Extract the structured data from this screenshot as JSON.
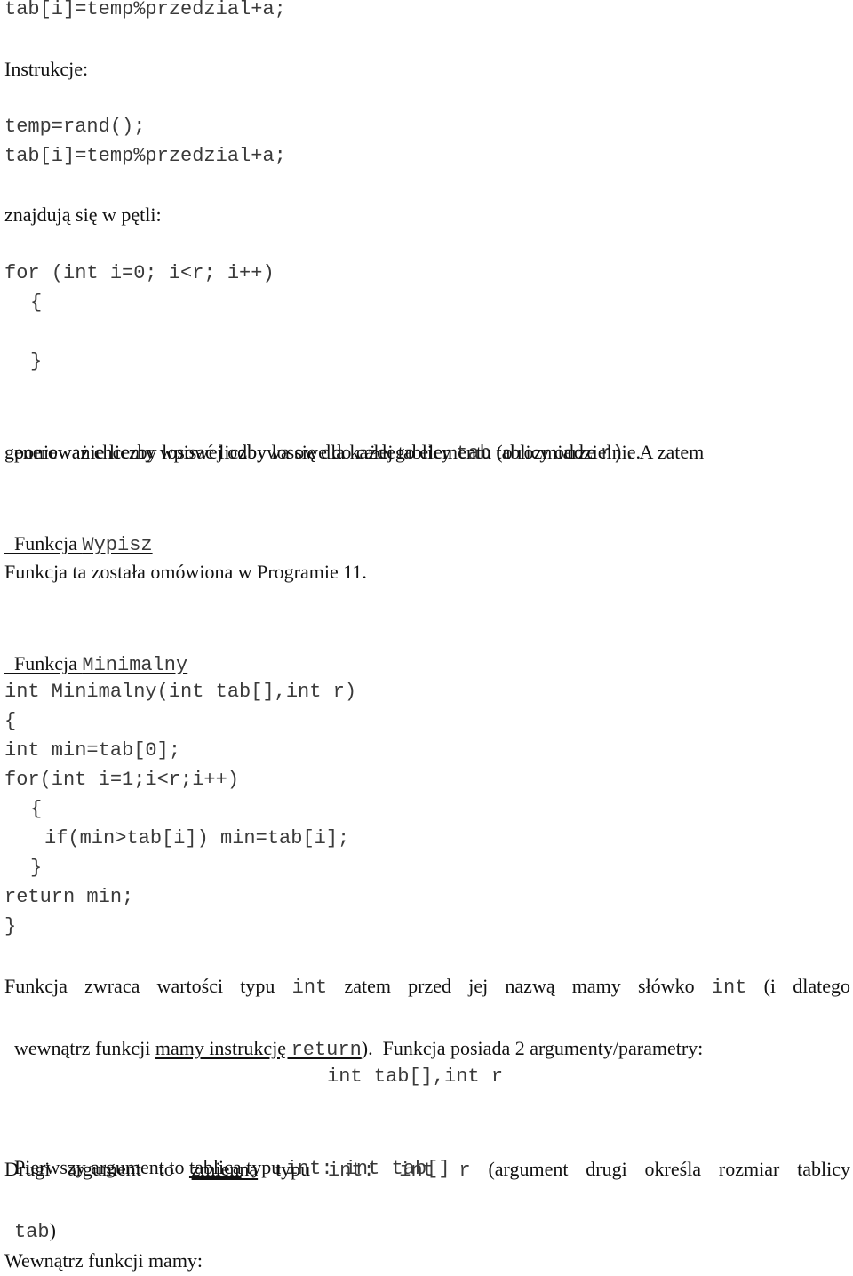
{
  "top_code": {
    "line1": "tab[i]=temp%przedzial+a;"
  },
  "instructions_heading": "Instrukcje:",
  "instructions_code": {
    "line1": "temp=rand();",
    "line2": "tab[i]=temp%przedzial+a;"
  },
  "loop_intro": "znajdują się w pętli:",
  "loop_code": {
    "header": "for (int i=0; i<r; i++)",
    "open_brace": "{",
    "close_brace": "}"
  },
  "explanation": {
    "part1": "ponieważ chcemy wpisać liczby losowe do całej tablicy ",
    "code_tab": "tab",
    "part2": " (o rozmiarze ",
    "code_r": "r).",
    "part3": " A zatem",
    "line2": "generowanie liczby losowej odbywa się dla każdego elementu tablicy oddzielnie."
  },
  "section_wypisz": {
    "label": "Funkcja ",
    "name": "Wypisz",
    "description": "Funkcja ta została omówiona w Programie 11."
  },
  "section_minimalny": {
    "label": "Funkcja ",
    "name": "Minimalny"
  },
  "minimalny_code": [
    "int Minimalny(int tab[],int r)",
    "{",
    "int min=tab[0];",
    "for(int i=1;i<r;i++)",
    "{",
    "if(min>tab[i]) min=tab[i];",
    "}",
    "return min;",
    "}"
  ],
  "return_paragraph": {
    "p1": "Funkcja zwraca wartości typu ",
    "c1": "int",
    "p2": " zatem przed jej nazwą mamy słówko ",
    "c2": "int",
    "p3": " (i dlatego",
    "p4": "wewnątrz funkcji ",
    "u1": "mamy instrukcję ",
    "c3": "return",
    "p5": ").  Funkcja posiada 2 argumenty/parametry:"
  },
  "params_code": "int tab[],int r",
  "first_arg": {
    "p1": "Pierwszy argument to ",
    "u1": "tablica",
    "p2": " typu ",
    "c1": "int: int tab[]"
  },
  "second_arg": {
    "p1": "Drugi argument to ",
    "u1": "zmienna",
    "p2": " typu ",
    "c1": "int:  int r",
    "p3": "  (argument drugi określa rozmiar tablicy",
    "c2": "tab",
    "p4": ")"
  },
  "inside_heading": "Wewnątrz funkcji mamy:"
}
